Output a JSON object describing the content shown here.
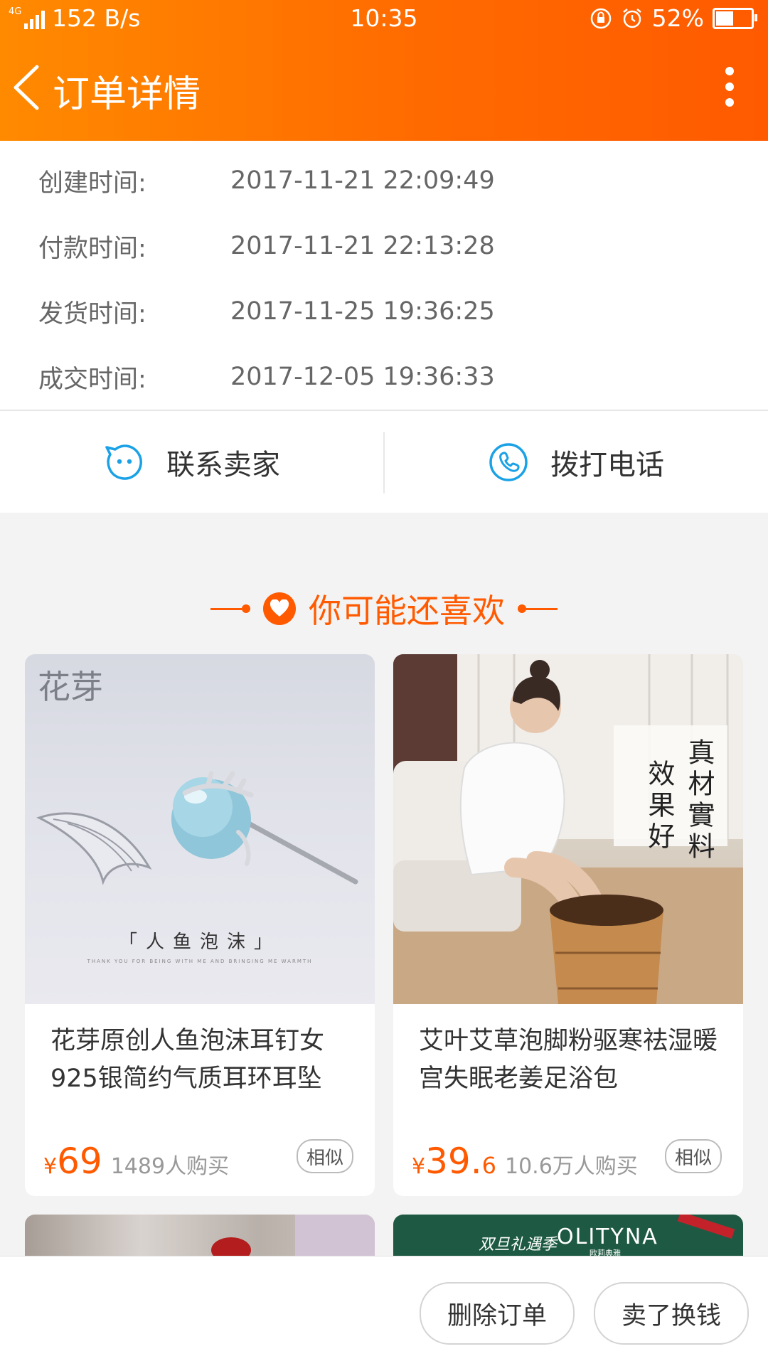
{
  "status_bar": {
    "network": "4G",
    "speed": "152 B/s",
    "time": "10:35",
    "battery": "52%",
    "battery_level": 0.52
  },
  "header": {
    "title": "订单详情"
  },
  "order_times": [
    {
      "label": "创建时间:",
      "value": "2017-11-21 22:09:49"
    },
    {
      "label": "付款时间:",
      "value": "2017-11-21 22:13:28"
    },
    {
      "label": "发货时间:",
      "value": "2017-11-25 19:36:25"
    },
    {
      "label": "成交时间:",
      "value": "2017-12-05 19:36:33"
    }
  ],
  "contact": {
    "seller_label": "联系卖家",
    "call_label": "拨打电话"
  },
  "recommend": {
    "heading": "你可能还喜欢",
    "accent_color": "#ff5a00",
    "products": [
      {
        "name": "花芽原创人鱼泡沫耳钉女925银简约气质耳环耳坠",
        "currency": "¥",
        "price_int": "69",
        "price_dec": "",
        "buyers": "1489人购买",
        "similar": "相似",
        "image_brand": "花芽",
        "image_caption": "「人鱼泡沫」",
        "image_small_text": "THANK YOU FOR BEING WITH ME AND BRINGING ME WARMTH"
      },
      {
        "name": "艾叶艾草泡脚粉驱寒祛湿暖宫失眠老姜足浴包",
        "currency": "¥",
        "price_int": "39.",
        "price_dec": "6",
        "buyers": "10.6万人购买",
        "similar": "相似",
        "image_text_1": "真材實料",
        "image_text_2": "效果好"
      }
    ],
    "peek_banner": {
      "tmall_badge": "双旦礼遇季",
      "brand": "OLITYNA",
      "brand_cn": "欧莉典雅"
    }
  },
  "bottom_bar": {
    "delete_order": "删除订单",
    "sell_for_cash": "卖了换钱"
  }
}
